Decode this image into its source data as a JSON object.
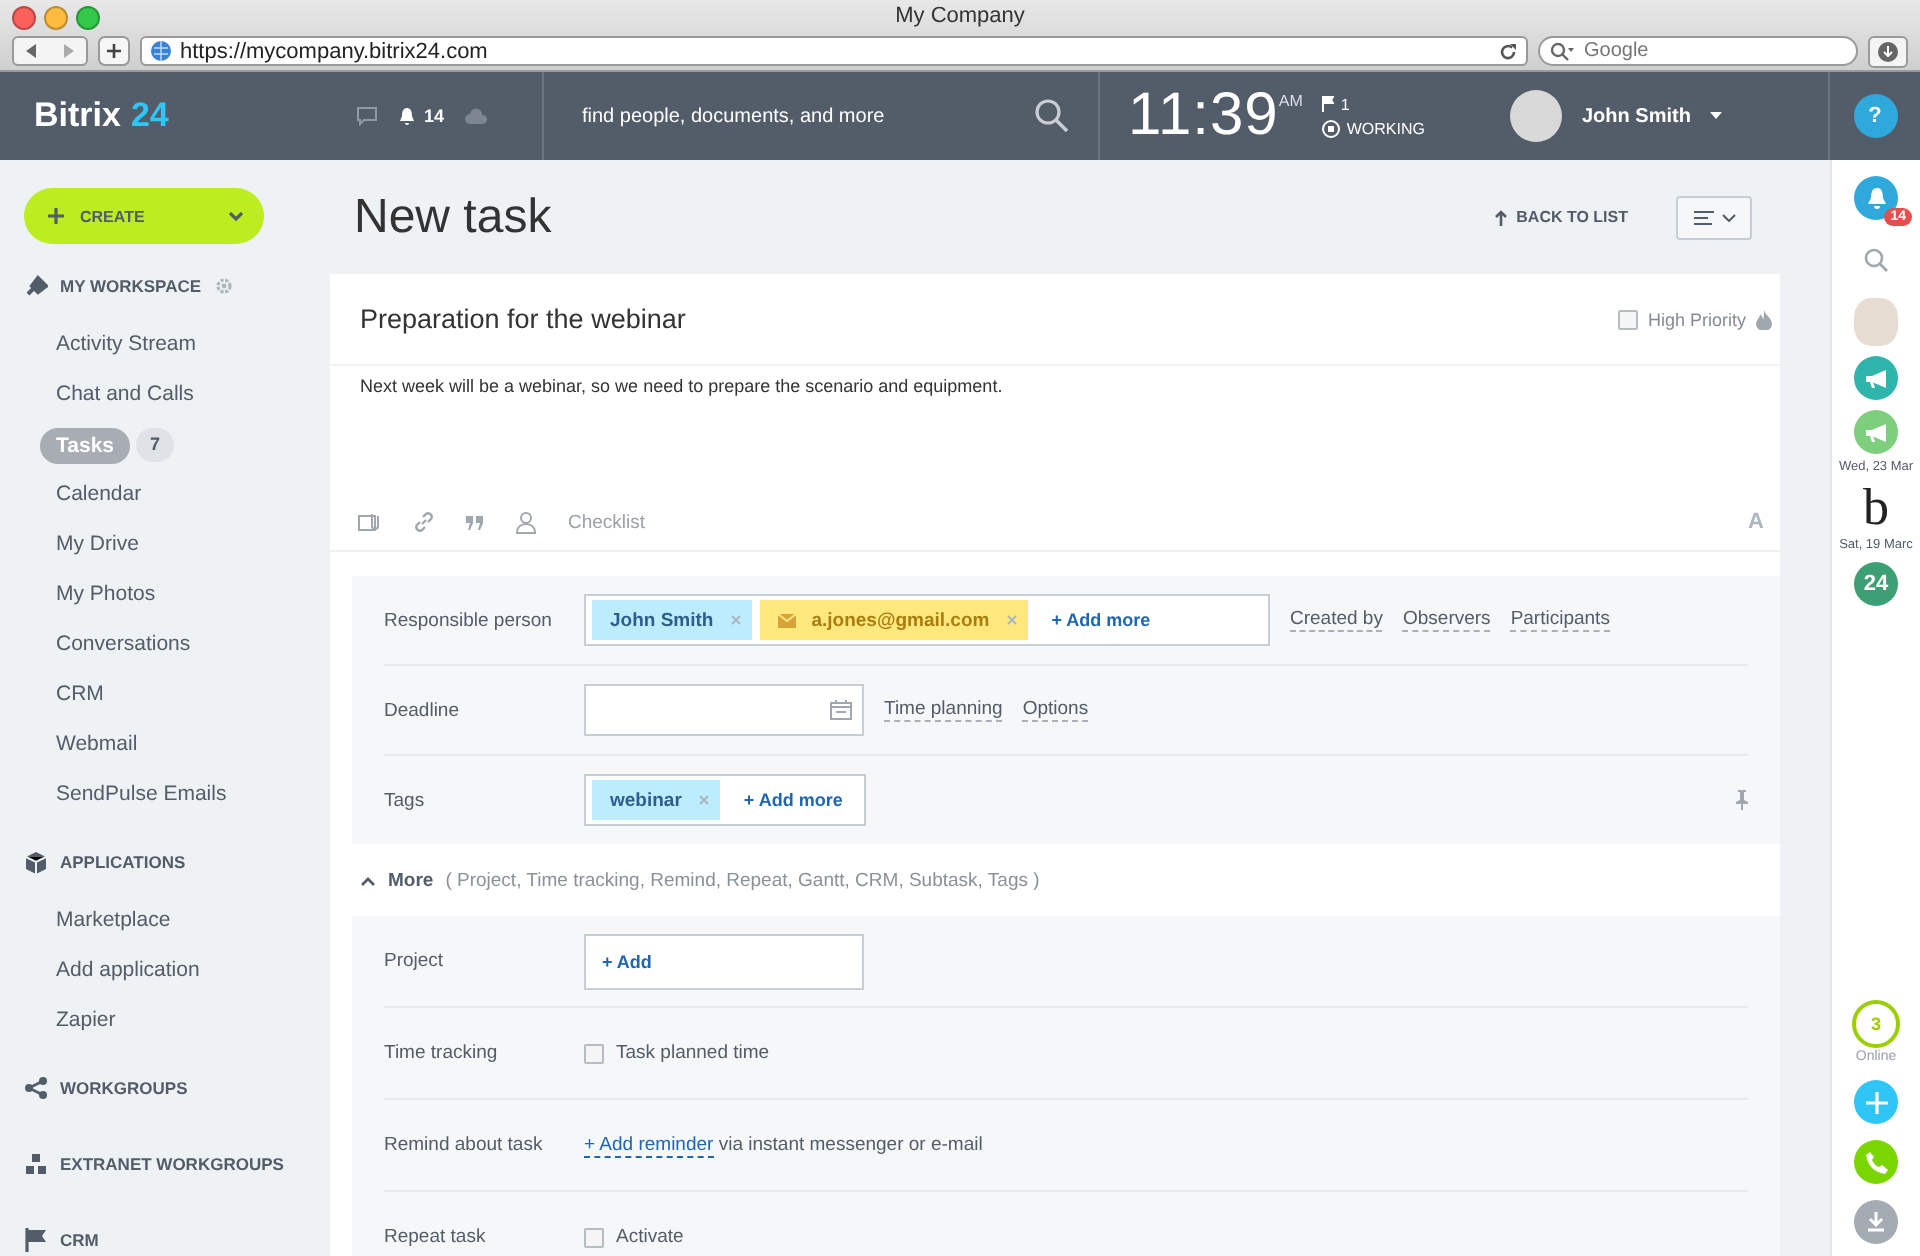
{
  "browser": {
    "title": "My Company",
    "url": "https://mycompany.bitrix24.com",
    "search_placeholder": "Google"
  },
  "header": {
    "logo": "Bitrix",
    "logo_accent": "24",
    "notifications": "14",
    "search_placeholder": "find people, documents, and more",
    "time": "11:39",
    "ampm": "AM",
    "flag_count": "1",
    "status": "WORKING",
    "user": "John Smith",
    "help": "?"
  },
  "sidebar": {
    "create": "CREATE",
    "sections": [
      {
        "kind": "workspace",
        "title": "MY WORKSPACE",
        "items": [
          {
            "label": "Activity Stream",
            "selected": false
          },
          {
            "label": "Chat and Calls",
            "selected": false
          },
          {
            "label": "Tasks",
            "selected": true,
            "count": "7"
          },
          {
            "label": "Calendar",
            "selected": false
          },
          {
            "label": "My Drive",
            "selected": false
          },
          {
            "label": "My Photos",
            "selected": false
          },
          {
            "label": "Conversations",
            "selected": false
          },
          {
            "label": "CRM",
            "selected": false
          },
          {
            "label": "Webmail",
            "selected": false
          },
          {
            "label": "SendPulse Emails",
            "selected": false
          }
        ]
      },
      {
        "kind": "applications",
        "title": "APPLICATIONS",
        "items": [
          {
            "label": "Marketplace",
            "selected": false
          },
          {
            "label": "Add application",
            "selected": false
          },
          {
            "label": "Zapier",
            "selected": false
          }
        ]
      },
      {
        "kind": "workgroups",
        "title": "WORKGROUPS"
      },
      {
        "kind": "extranet",
        "title": "EXTRANET WORKGROUPS"
      },
      {
        "kind": "crm",
        "title": "CRM"
      }
    ]
  },
  "page": {
    "title": "New task",
    "back": "BACK TO LIST"
  },
  "task": {
    "title": "Preparation for the webinar",
    "high_priority": {
      "label": "High Priority",
      "checked": false
    },
    "description": "Next week will be a webinar, so we need to prepare the scenario and equipment.",
    "checklist": "Checklist",
    "format": "A"
  },
  "fields": [
    {
      "kind": "people",
      "label": "Responsible person",
      "members": [
        {
          "kind": "user",
          "name": "John Smith"
        },
        {
          "kind": "email",
          "name": "a.jones@gmail.com"
        }
      ],
      "add": "+ Add more",
      "links": [
        "Created by",
        "Observers",
        "Participants"
      ]
    },
    {
      "kind": "date",
      "label": "Deadline",
      "links": [
        "Time planning",
        "Options"
      ]
    },
    {
      "kind": "tags",
      "label": "Tags",
      "tags": [
        "webinar"
      ],
      "add": "+ Add more"
    }
  ],
  "more": {
    "label": "More",
    "expanded": true,
    "summary": "( Project,  Time tracking,  Remind,  Repeat,  Gantt,  CRM,  Subtask,  Tags )"
  },
  "extra_fields": [
    {
      "kind": "add",
      "label": "Project",
      "add": "+ Add"
    },
    {
      "kind": "checkbox",
      "label": "Time tracking",
      "option": "Task planned time",
      "checked": false
    },
    {
      "kind": "reminder",
      "label": "Remind about task",
      "link": "+ Add reminder",
      "text": "via instant messenger or e-mail"
    },
    {
      "kind": "checkbox",
      "label": "Repeat task",
      "option": "Activate",
      "checked": false
    }
  ],
  "rightbar": {
    "notifications": "14",
    "items": [
      {
        "kind": "avatar"
      },
      {
        "kind": "megaphone",
        "color": "#2fb5ac"
      },
      {
        "kind": "megaphone",
        "color": "#7dce7d",
        "date": "Wed, 23 Mar"
      },
      {
        "kind": "logo",
        "text": "b",
        "date": "Sat, 19 Marc"
      },
      {
        "kind": "badge",
        "text": "24",
        "color": "#3e9e74"
      }
    ],
    "online": "3",
    "online_label": "Online"
  }
}
